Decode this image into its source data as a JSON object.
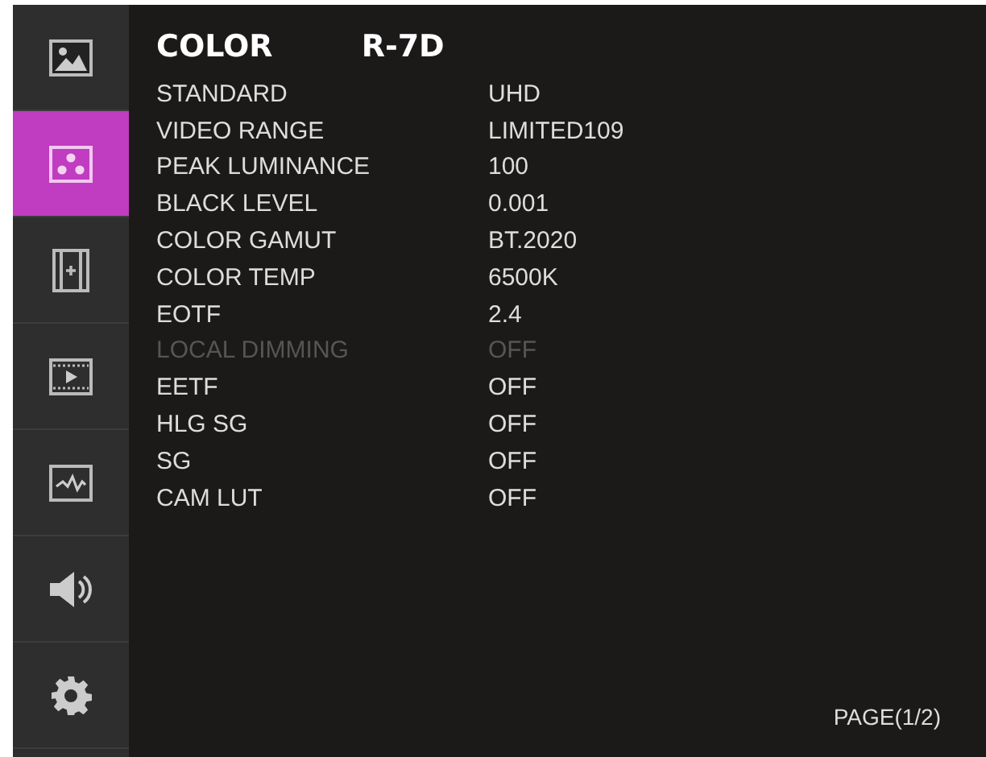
{
  "sidebar": {
    "items": [
      {
        "kind": "picture",
        "selected": false
      },
      {
        "kind": "color",
        "selected": true
      },
      {
        "kind": "frame",
        "selected": false
      },
      {
        "kind": "video",
        "selected": false
      },
      {
        "kind": "waveform",
        "selected": false
      },
      {
        "kind": "audio",
        "selected": false
      },
      {
        "kind": "settings",
        "selected": false
      }
    ]
  },
  "menu": {
    "title": "COLOR",
    "model": "R-7D",
    "rows": [
      {
        "label": "STANDARD",
        "value": "UHD",
        "disabled": false
      },
      {
        "label": "VIDEO RANGE",
        "value": "LIMITED109",
        "disabled": false
      },
      {
        "label": "PEAK LUMINANCE",
        "value": "100",
        "disabled": false
      },
      {
        "label": "BLACK LEVEL",
        "value": "0.001",
        "disabled": false
      },
      {
        "label": "COLOR GAMUT",
        "value": "BT.2020",
        "disabled": false
      },
      {
        "label": "COLOR TEMP",
        "value": "6500K",
        "disabled": false
      },
      {
        "label": "EOTF",
        "value": "2.4",
        "disabled": false
      },
      {
        "label": "LOCAL DIMMING",
        "value": "OFF",
        "disabled": true
      },
      {
        "label": "EETF",
        "value": "OFF",
        "disabled": false
      },
      {
        "label": "HLG SG",
        "value": "OFF",
        "disabled": false
      },
      {
        "label": "SG",
        "value": "OFF",
        "disabled": false
      },
      {
        "label": "CAM LUT",
        "value": "OFF",
        "disabled": false
      }
    ],
    "page": "PAGE(1/2)"
  }
}
